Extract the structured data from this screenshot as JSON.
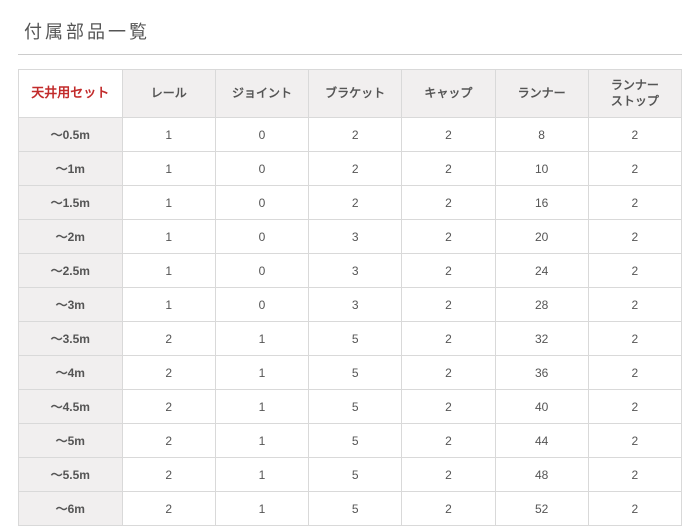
{
  "title": "付属部品一覧",
  "corner_label": "天井用セット",
  "columns": [
    "レール",
    "ジョイント",
    "ブラケット",
    "キャップ",
    "ランナー",
    "ランナー\nストップ"
  ],
  "rows": [
    {
      "label": "～0.5m",
      "values": [
        1,
        0,
        2,
        2,
        8,
        2
      ]
    },
    {
      "label": "～1m",
      "values": [
        1,
        0,
        2,
        2,
        10,
        2
      ]
    },
    {
      "label": "～1.5m",
      "values": [
        1,
        0,
        2,
        2,
        16,
        2
      ]
    },
    {
      "label": "～2m",
      "values": [
        1,
        0,
        3,
        2,
        20,
        2
      ]
    },
    {
      "label": "～2.5m",
      "values": [
        1,
        0,
        3,
        2,
        24,
        2
      ]
    },
    {
      "label": "～3m",
      "values": [
        1,
        0,
        3,
        2,
        28,
        2
      ]
    },
    {
      "label": "～3.5m",
      "values": [
        2,
        1,
        5,
        2,
        32,
        2
      ]
    },
    {
      "label": "～4m",
      "values": [
        2,
        1,
        5,
        2,
        36,
        2
      ]
    },
    {
      "label": "～4.5m",
      "values": [
        2,
        1,
        5,
        2,
        40,
        2
      ]
    },
    {
      "label": "～5m",
      "values": [
        2,
        1,
        5,
        2,
        44,
        2
      ]
    },
    {
      "label": "～5.5m",
      "values": [
        2,
        1,
        5,
        2,
        48,
        2
      ]
    },
    {
      "label": "～6m",
      "values": [
        2,
        1,
        5,
        2,
        52,
        2
      ]
    }
  ]
}
